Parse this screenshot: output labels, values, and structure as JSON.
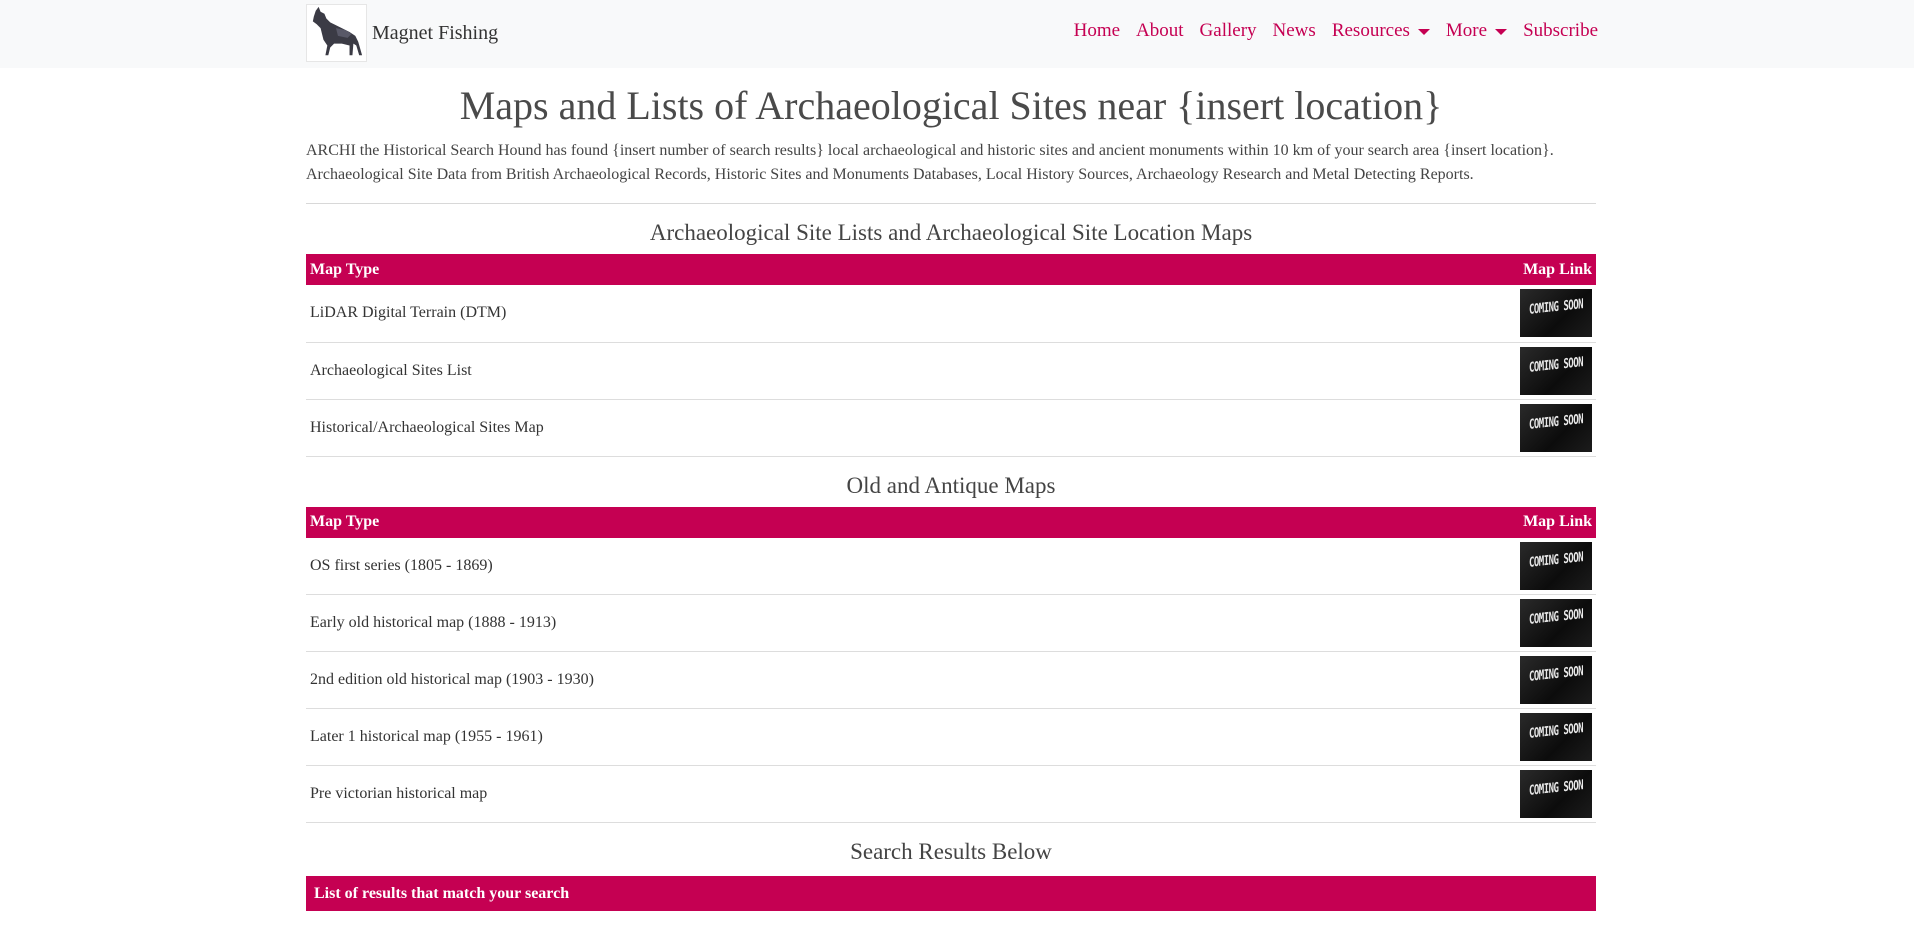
{
  "nav": {
    "brand": "Magnet Fishing",
    "items": [
      {
        "label": "Home",
        "dropdown": false
      },
      {
        "label": "About",
        "dropdown": false
      },
      {
        "label": "Gallery",
        "dropdown": false
      },
      {
        "label": "News",
        "dropdown": false
      },
      {
        "label": "Resources",
        "dropdown": true
      },
      {
        "label": "More",
        "dropdown": true
      },
      {
        "label": "Subscribe",
        "dropdown": false
      }
    ],
    "accent": "#c50052"
  },
  "page": {
    "title": "Maps and Lists of Archaeological Sites near {insert location}",
    "intro_line1": "ARCHI the Historical Search Hound has found {insert number of search results} local archaeological and historic sites and ancient monuments within 10 km of your search area {insert location}.",
    "intro_line2": "Archaeological Site Data from British Archaeological Records, Historic Sites and Monuments Databases, Local History Sources, Archaeology Research and Metal Detecting Reports."
  },
  "sections": [
    {
      "title": "Archaeological Site Lists and Archaeological Site Location Maps",
      "col_type": "Map Type",
      "col_link": "Map Link",
      "rows": [
        {
          "label": "LiDAR Digital Terrain (DTM)",
          "link_text": "COMING SOON"
        },
        {
          "label": "Archaeological Sites List",
          "link_text": "COMING SOON"
        },
        {
          "label": "Historical/Archaeological Sites Map",
          "link_text": "COMING SOON"
        }
      ]
    },
    {
      "title": "Old and Antique Maps",
      "col_type": "Map Type",
      "col_link": "Map Link",
      "rows": [
        {
          "label": "OS first series (1805 - 1869)",
          "link_text": "COMING SOON"
        },
        {
          "label": "Early old historical map (1888 - 1913)",
          "link_text": "COMING SOON"
        },
        {
          "label": "2nd edition old historical map (1903 - 1930)",
          "link_text": "COMING SOON"
        },
        {
          "label": "Later 1 historical map (1955 - 1961)",
          "link_text": "COMING SOON"
        },
        {
          "label": "Pre victorian historical map",
          "link_text": "COMING SOON"
        }
      ]
    }
  ],
  "results": {
    "title": "Search Results Below",
    "bar_label": "List of results that match your search"
  }
}
